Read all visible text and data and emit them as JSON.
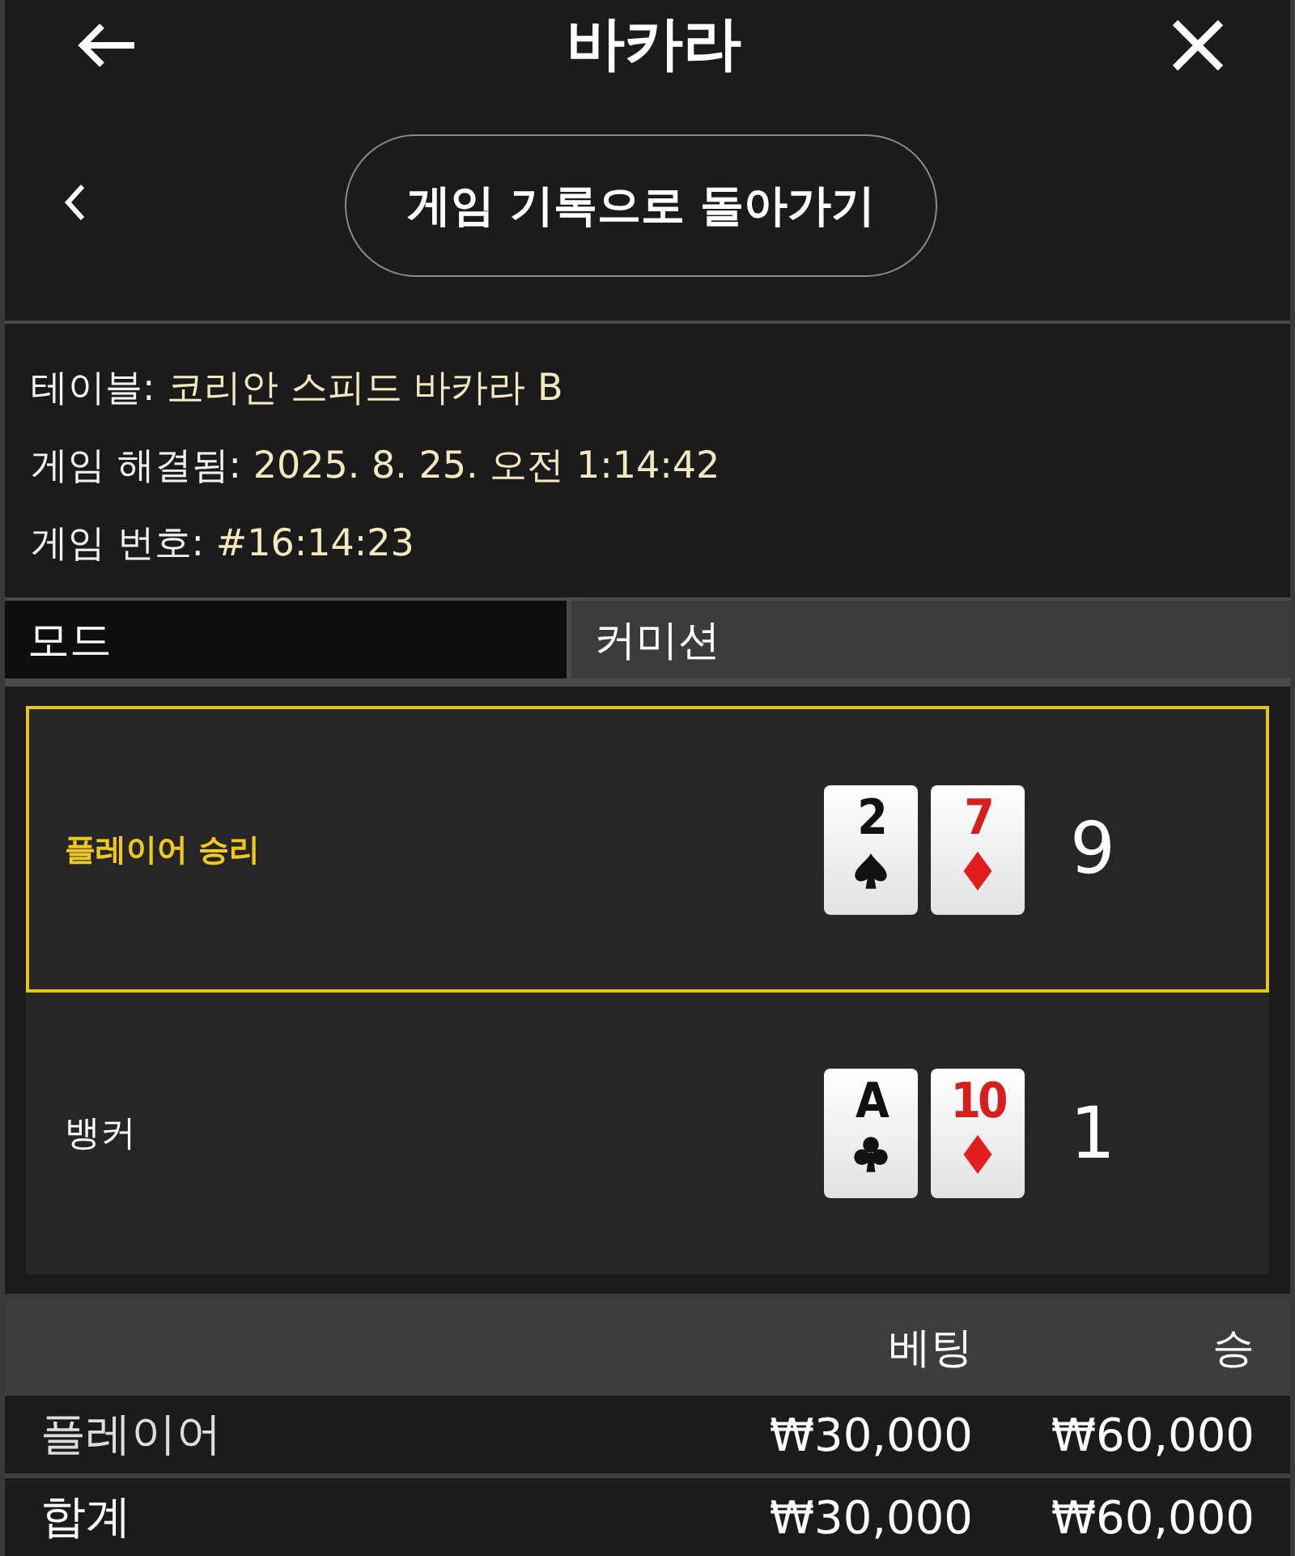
{
  "header": {
    "title": "바카라"
  },
  "back_link": {
    "label": "게임 기록으로 돌아가기"
  },
  "info": [
    {
      "label": "테이블:",
      "value": "코리안 스피드 바카라 B"
    },
    {
      "label": "게임 해결됨:",
      "value": "2025. 8. 25. 오전 1:14:42"
    },
    {
      "label": "게임 번호:",
      "value": "#16:14:23"
    }
  ],
  "mode": {
    "label": "모드",
    "value": "커미션"
  },
  "hands": [
    {
      "label": "플레이어 승리",
      "winner": true,
      "score": "9",
      "cards": [
        {
          "rank": "2",
          "kind": "spades"
        },
        {
          "rank": "7",
          "kind": "diamonds"
        }
      ]
    },
    {
      "label": "뱅커",
      "winner": false,
      "score": "1",
      "cards": [
        {
          "rank": "A",
          "kind": "clubs"
        },
        {
          "rank": "10",
          "kind": "diamonds"
        }
      ]
    }
  ],
  "bets": {
    "columns": [
      "베팅",
      "승"
    ],
    "rows": [
      {
        "name": "플레이어",
        "bet": "₩30,000",
        "win": "₩60,000"
      },
      {
        "name": "합계",
        "bet": "₩30,000",
        "win": "₩60,000",
        "kind": "total"
      }
    ]
  }
}
